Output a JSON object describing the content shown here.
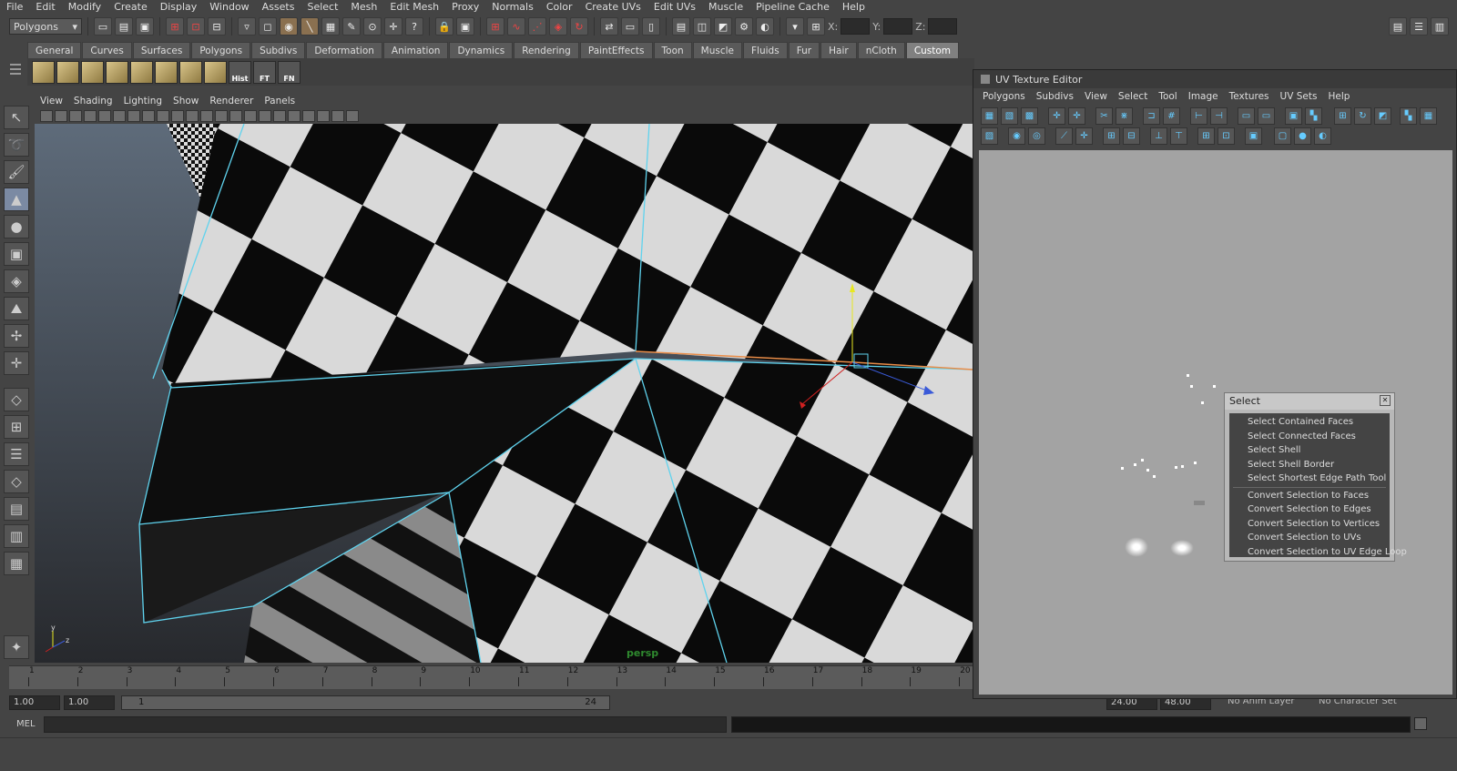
{
  "menubar": [
    "File",
    "Edit",
    "Modify",
    "Create",
    "Display",
    "Window",
    "Assets",
    "Select",
    "Mesh",
    "Edit Mesh",
    "Proxy",
    "Normals",
    "Color",
    "Create UVs",
    "Edit UVs",
    "Muscle",
    "Pipeline Cache",
    "Help"
  ],
  "statusline": {
    "mode": "Polygons",
    "x_label": "X:",
    "y_label": "Y:",
    "z_label": "Z:"
  },
  "shelf": {
    "tabs": [
      "General",
      "Curves",
      "Surfaces",
      "Polygons",
      "Subdivs",
      "Deformation",
      "Animation",
      "Dynamics",
      "Rendering",
      "PaintEffects",
      "Toon",
      "Muscle",
      "Fluids",
      "Fur",
      "Hair",
      "nCloth",
      "Custom"
    ],
    "active_tab": "Custom",
    "icons": [
      "",
      "",
      "",
      "",
      "",
      "",
      "",
      "",
      "Hist",
      "FT",
      "FN"
    ]
  },
  "viewport": {
    "menu": [
      "View",
      "Shading",
      "Lighting",
      "Show",
      "Renderer",
      "Panels"
    ],
    "camera_label": "persp"
  },
  "timeline": {
    "ticks": [
      "1",
      "2",
      "3",
      "4",
      "5",
      "6",
      "7",
      "8",
      "9",
      "10",
      "11",
      "12",
      "13",
      "14",
      "15",
      "16",
      "17",
      "18",
      "19",
      "20"
    ]
  },
  "range": {
    "start": "1.00",
    "current": "1.00",
    "range_start": "1",
    "range_end": "24",
    "anim_end": "24.00",
    "playback_end": "48.00",
    "anim_layer": "No Anim Layer",
    "character_set": "No Character Set"
  },
  "cmdline": {
    "label": "MEL"
  },
  "uv_editor": {
    "title": "UV Texture Editor",
    "menu": [
      "Polygons",
      "Subdivs",
      "View",
      "Select",
      "Tool",
      "Image",
      "Textures",
      "UV Sets",
      "Help"
    ]
  },
  "select_popup": {
    "title": "Select",
    "group1": [
      "Select Contained Faces",
      "Select Connected Faces",
      "Select Shell",
      "Select Shell Border",
      "Select Shortest Edge Path Tool"
    ],
    "group2": [
      "Convert Selection to Faces",
      "Convert Selection to Edges",
      "Convert Selection to Vertices",
      "Convert Selection to UVs",
      "Convert Selection to UV Edge Loop"
    ]
  }
}
